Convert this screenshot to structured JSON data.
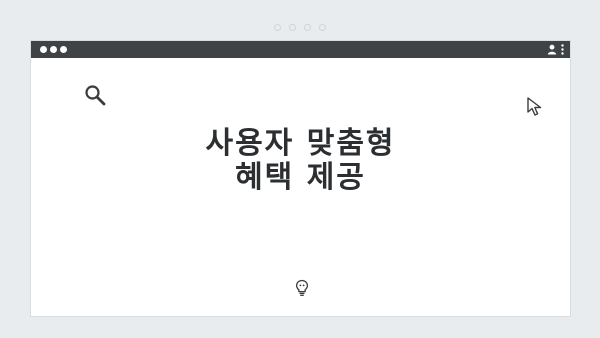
{
  "window": {
    "headline_line1": "사용자 맞춤형",
    "headline_line2": "혜택 제공"
  },
  "icons": {
    "search": "search-icon",
    "cursor": "cursor-icon",
    "bulb": "lightbulb-icon",
    "user": "user-icon",
    "menu": "kebab-menu-icon"
  },
  "colors": {
    "background": "#e9ecef",
    "titlebar": "#3f4346",
    "window": "#ffffff",
    "text": "#2c2f31"
  }
}
